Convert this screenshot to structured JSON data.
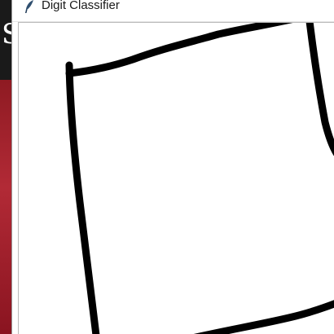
{
  "window": {
    "title": "Digit Classifier",
    "icon": "feather-icon"
  },
  "backdrop": {
    "letter": "S"
  },
  "canvas": {
    "stroke_color": "#000000",
    "background_color": "#ffffff"
  }
}
